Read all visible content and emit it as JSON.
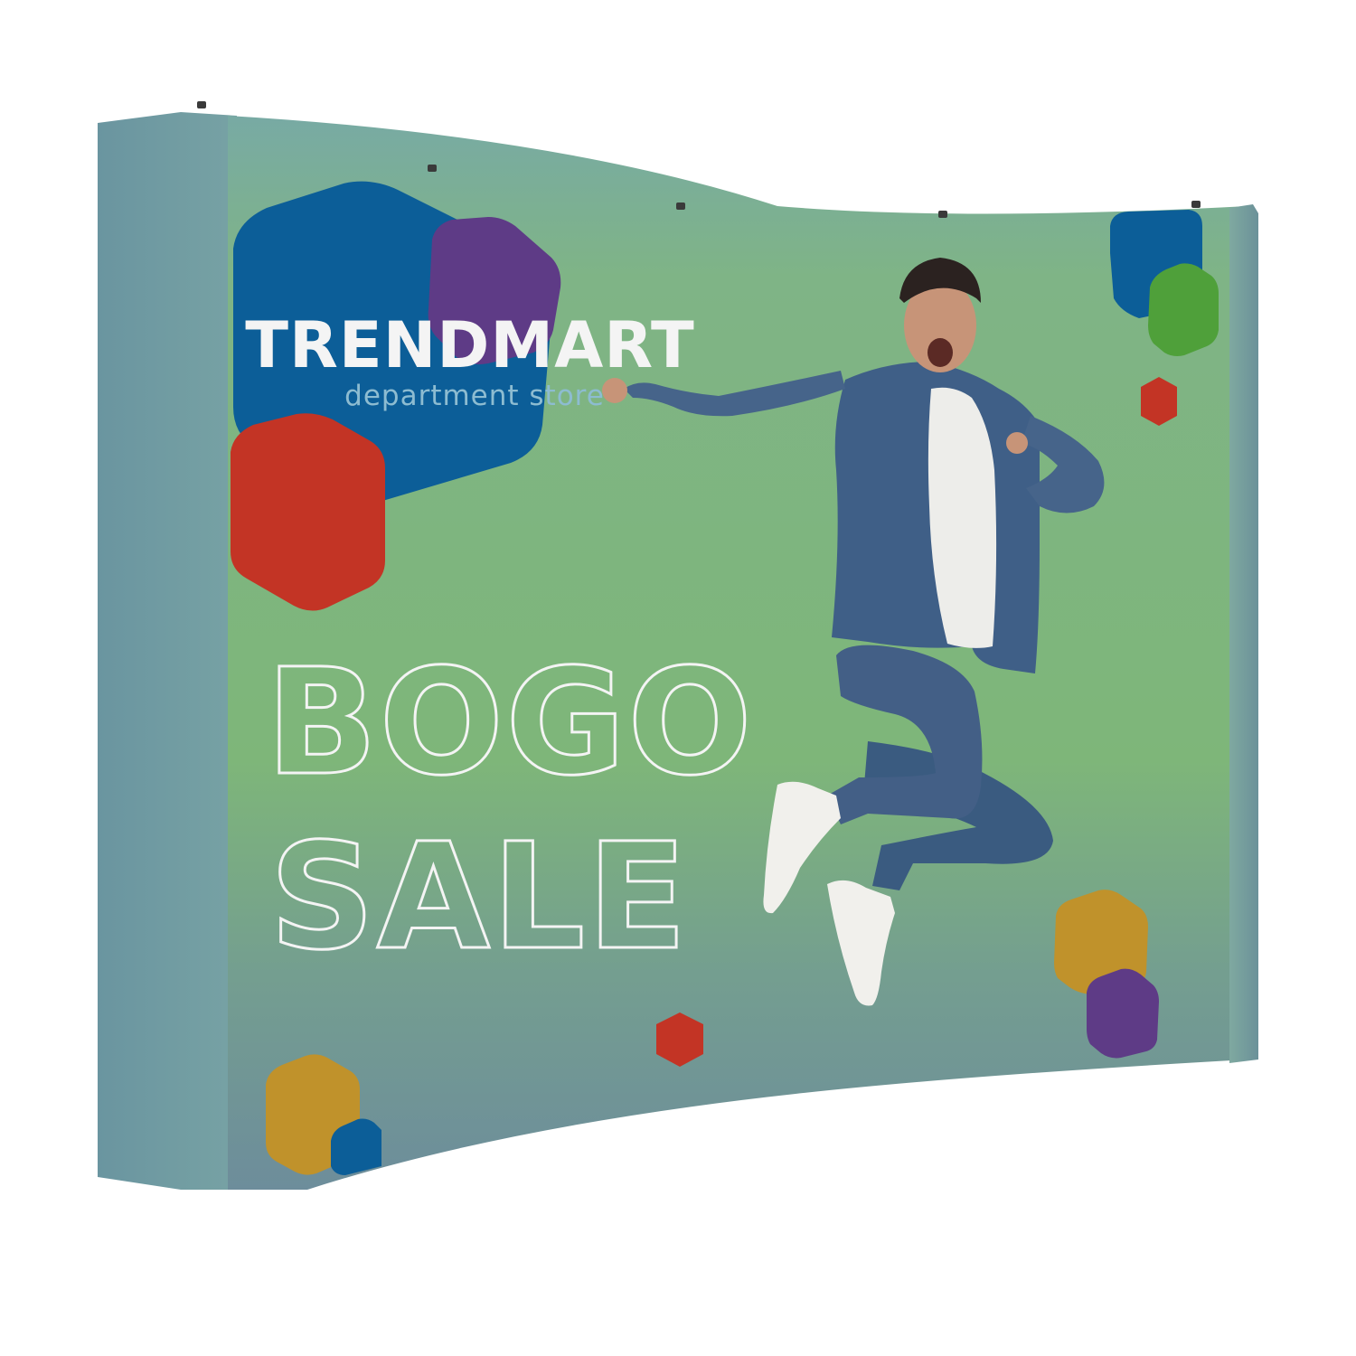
{
  "brand": {
    "name": "TRENDMART",
    "tagline": "department store"
  },
  "promo": {
    "line1": "BOGO",
    "line2": "SALE"
  },
  "colors": {
    "background": "#ffffff",
    "wall_green": "#7fb882",
    "wall_teal": "#6f9a9c",
    "side_panel": "#6f99a0",
    "hex_blue": "#0c5e98",
    "hex_purple": "#5e3b86",
    "hex_red": "#c33425",
    "hex_green": "#4fa03a",
    "hex_gold": "#c0922b",
    "text_white": "#f4f4f4",
    "denim": "#3e5f86",
    "shirt": "#ededea"
  },
  "icons": {
    "person": "jumping-man-photo",
    "shapes": "hexagon-decoration"
  }
}
